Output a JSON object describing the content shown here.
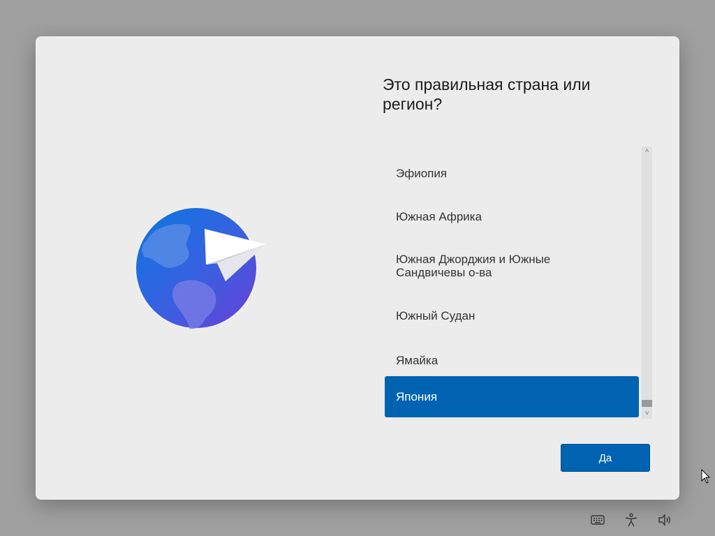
{
  "dialog": {
    "title": "Это правильная страна или регион?"
  },
  "region_list": {
    "items": [
      {
        "label": "Эфиопия",
        "selected": false
      },
      {
        "label": "Южная Африка",
        "selected": false
      },
      {
        "label": "Южная Джорджия и Южные Сандвичевы о-ва",
        "selected": false
      },
      {
        "label": "Южный Судан",
        "selected": false
      },
      {
        "label": "Ямайка",
        "selected": false
      },
      {
        "label": "Япония",
        "selected": true
      }
    ],
    "scroll_up_glyph": "˄",
    "scroll_down_glyph": "˅"
  },
  "actions": {
    "yes_label": "Да"
  },
  "taskbar": {
    "icons": [
      "keyboard-icon",
      "accessibility-icon",
      "volume-icon"
    ]
  },
  "colors": {
    "accent": "#0063b1",
    "dialog_bg": "#ececec",
    "backdrop": "#a0a0a0"
  }
}
